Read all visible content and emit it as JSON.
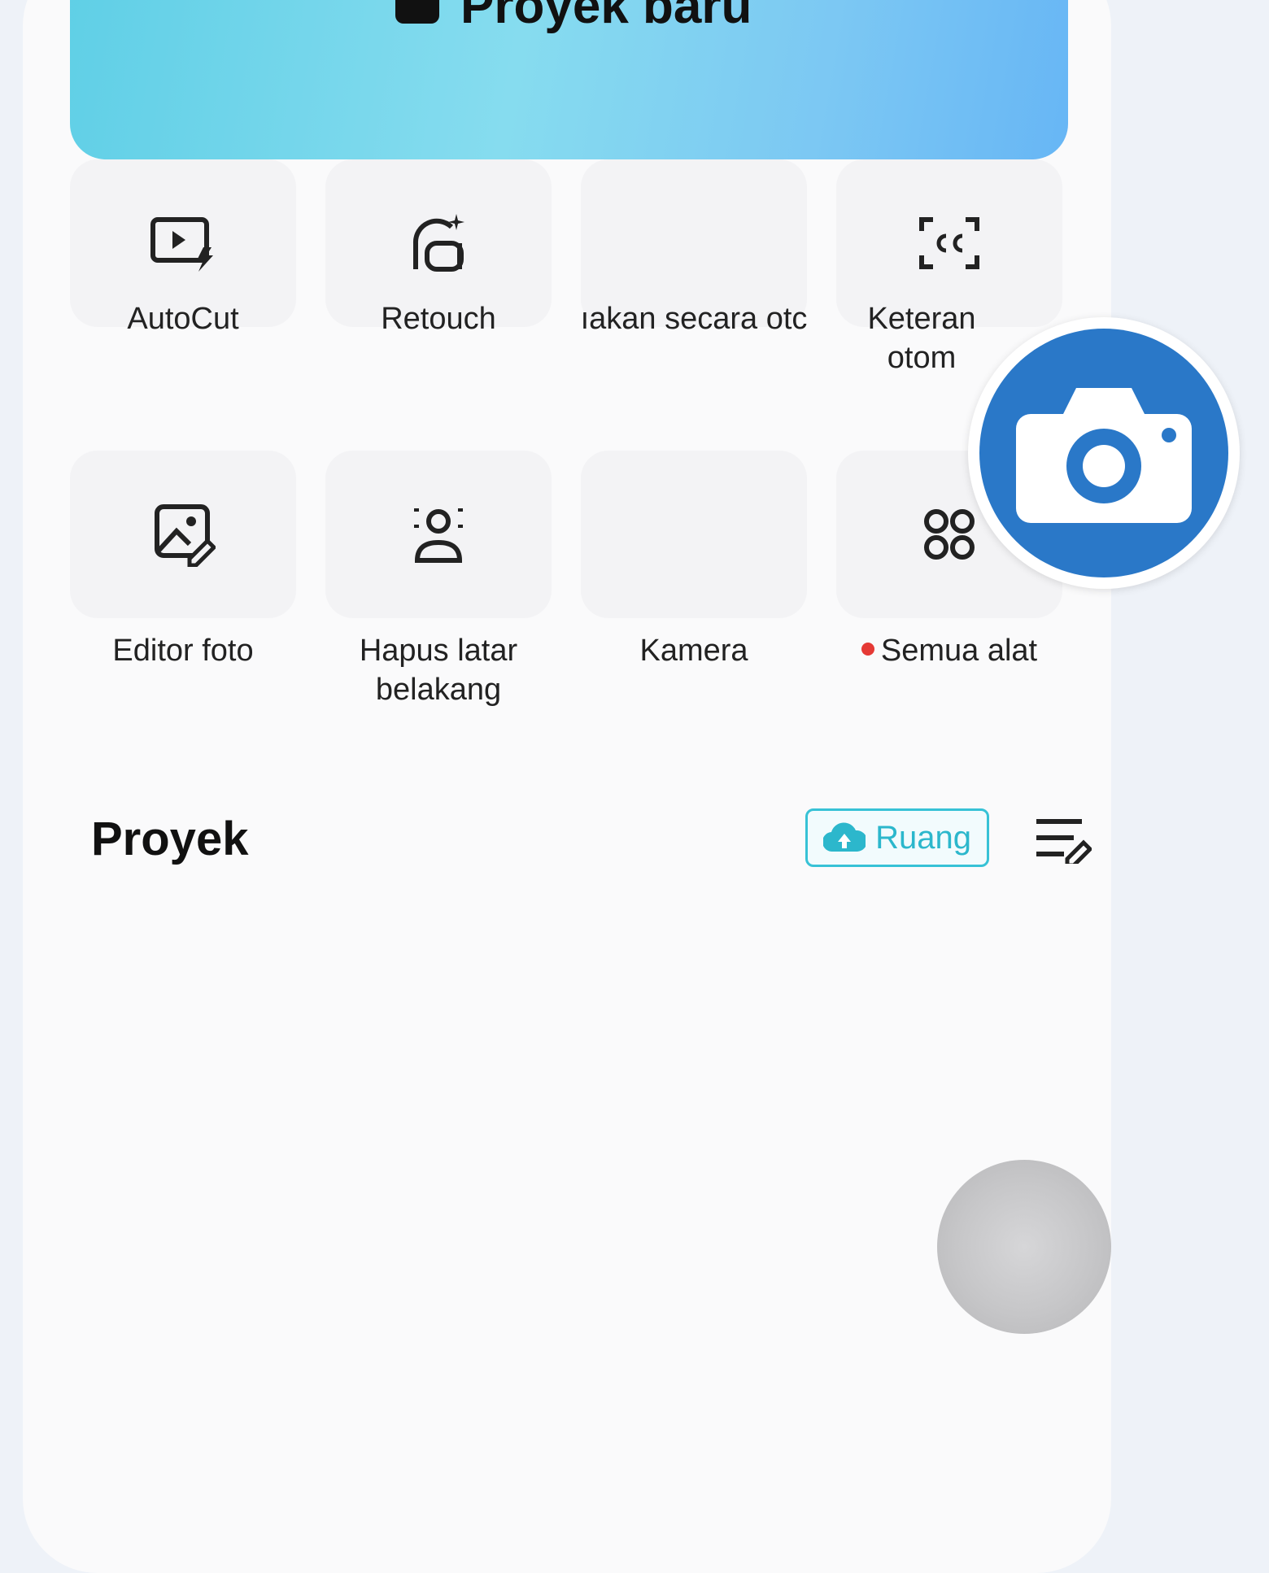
{
  "banner": {
    "label": "Proyek baru"
  },
  "tools": [
    {
      "label": "AutoCut",
      "icon": "autocut-icon"
    },
    {
      "label": "Retouch",
      "icon": "retouch-icon"
    },
    {
      "label": "ıakan secara otc",
      "icon": ""
    },
    {
      "label": "Keteran otom",
      "icon": "captions-icon"
    },
    {
      "label": "Editor foto",
      "icon": "photo-editor-icon"
    },
    {
      "label": "Hapus latar belakang",
      "icon": "remove-background-icon"
    },
    {
      "label": "Kamera",
      "icon": ""
    },
    {
      "label": "Semua alat",
      "icon": "all-tools-icon",
      "badge": "new-dot"
    }
  ],
  "projects": {
    "title": "Proyek",
    "space_button": "Ruang"
  },
  "colors": {
    "accent": "#37c2d6",
    "camera_badge": "#2a78c8",
    "banner_start": "#5fcfe6",
    "banner_end": "#67b6f5",
    "dot": "#e53935"
  }
}
